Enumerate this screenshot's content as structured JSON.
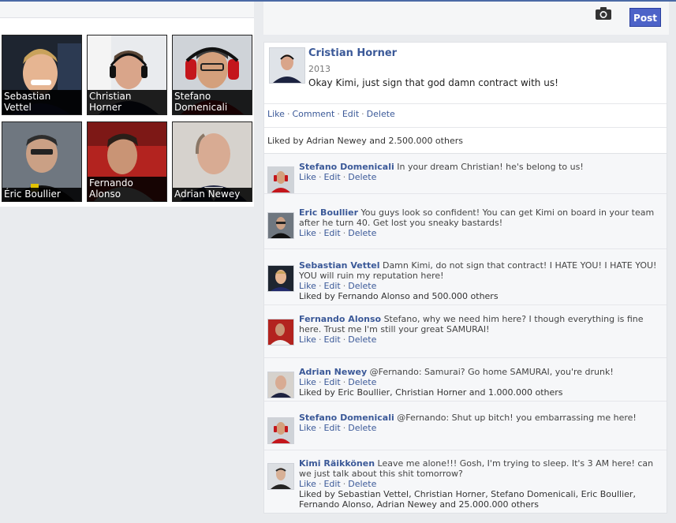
{
  "top_bar": {
    "post_label": "Post",
    "camera_icon": "camera-icon"
  },
  "friends": [
    {
      "label": "Sebastian Vettel"
    },
    {
      "label": "Christian Horner"
    },
    {
      "label": "Stefano Domenicali"
    },
    {
      "label": "Éric Boullier"
    },
    {
      "label": "Fernando Alonso"
    },
    {
      "label": "Adrian Newey"
    }
  ],
  "post": {
    "author": "Cristian Horner",
    "year": "2013",
    "text": "Okay Kimi, just sign that god damn contract with us!",
    "actions": [
      "Like",
      "Comment",
      "Edit",
      "Delete"
    ],
    "likes": "Liked by Adrian Newey and 2.500.000 others"
  },
  "comments": [
    {
      "author": "Stefano Domenicali",
      "text": "In your dream Christian! he's belong to us!",
      "likes": ""
    },
    {
      "author": "Eric Boullier",
      "text": "You guys look so confident! You can get Kimi on board in your team after he turn 40. Get lost you sneaky bastards!",
      "likes": ""
    },
    {
      "author": "Sebastian Vettel",
      "text": "Damn Kimi, do not sign that contract! I HATE YOU! I HATE YOU! YOU will ruin my reputation here!",
      "likes": "Liked by Fernando Alonso and 500.000 others"
    },
    {
      "author": "Fernando Alonso",
      "text": "Stefano, why we need him here? I though everything is fine here. Trust me I'm still your great SAMURAI!",
      "likes": ""
    },
    {
      "author": "Adrian Newey",
      "text": "@Fernando: Samurai? Go home SAMURAI, you're drunk!",
      "likes": "Liked by Eric Boullier, Christian Horner and 1.000.000 others"
    },
    {
      "author": "Stefano Domenicali",
      "text": "@Fernando: Shut up bitch! you embarrassing me here!",
      "likes": ""
    },
    {
      "author": "Kimi Räikkönen",
      "text": "Leave me alone!!! Gosh, I'm trying to sleep. It's 3 AM here! can we just talk about this shit tomorrow?",
      "likes": "Liked by Sebastian Vettel, Christian Horner, Stefano Domenicali, Eric Boullier, Fernando Alonso, Adrian Newey and 25.000.000 others"
    }
  ],
  "comment_actions": [
    "Like",
    "Edit",
    "Delete"
  ]
}
